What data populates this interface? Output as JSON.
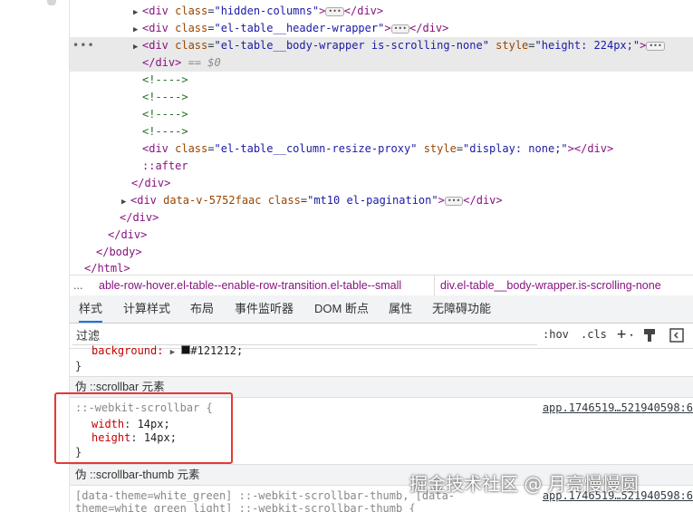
{
  "dom_tree": {
    "row1": {
      "tag_open": "<div ",
      "attr": "class",
      "val": "\"hidden-columns\"",
      "tag_close": ">",
      "end": "</div>"
    },
    "row2": {
      "tag_open": "<div ",
      "attr": "class",
      "val": "\"el-table__header-wrapper\"",
      "tag_close": ">",
      "end": "</div>"
    },
    "row3": {
      "tag_open": "<div ",
      "attr": "class",
      "val": "\"el-table__body-wrapper is-scrolling-none\"",
      "attr2": "style",
      "val2": "\"height: 224px;\"",
      "tag_close": ">"
    },
    "row4": {
      "end": "</div>",
      "marker": "== $0"
    },
    "comment": "<!---->",
    "row9": {
      "tag_open": "<div ",
      "attr": "class",
      "val": "\"el-table__column-resize-proxy\"",
      "attr2": "style",
      "val2": "\"display: none;\"",
      "tag_close": ">",
      "end": "</div>"
    },
    "after": "::after",
    "close_div": "</div>",
    "row12": {
      "tag_open": "<div ",
      "attr": "data-v-5752faac",
      "attr2": "class",
      "val2": "\"mt10 el-pagination\"",
      "tag_close": ">",
      "end": "</div>"
    },
    "close_body": "</body>",
    "close_html": "</html>"
  },
  "breadcrumb": {
    "dots": "...",
    "item1": "able-row-hover.el-table--enable-row-transition.el-table--small",
    "item2": "div.el-table__body-wrapper.is-scrolling-none"
  },
  "tabs": [
    "样式",
    "计算样式",
    "布局",
    "事件监听器",
    "DOM 断点",
    "属性",
    "无障碍功能"
  ],
  "filter": {
    "placeholder": "过滤",
    "hov": ":hov",
    "cls": ".cls",
    "plus": "+"
  },
  "styles": {
    "top_prop": "background:",
    "top_val": "#121212;",
    "brace_close": "}",
    "section1": "伪 ::scrollbar 元素",
    "rule1_selector": "::-webkit-scrollbar {",
    "rule1_source": "app.1746519…521940598:6",
    "rule1_props": [
      {
        "name": "width",
        "value": "14px;"
      },
      {
        "name": "height",
        "value": "14px;"
      }
    ],
    "section2": "伪 ::scrollbar-thumb 元素",
    "rule2_selector_line1": "[data-theme=white_green] ::-webkit-scrollbar-thumb, [data-",
    "rule2_selector_line2": "theme=white_green_light] ::-webkit-scrollbar-thumb {",
    "rule2_source": "app.1746519…521940598:6"
  },
  "watermark": "掘金技术社区 @ 月亮慢慢圆",
  "colors": {
    "tag": "#881280",
    "attr": "#994500",
    "value": "#1a1aa6",
    "comment": "#236e25",
    "highlight": "#e53935",
    "active_tab": "#1a73e8"
  }
}
